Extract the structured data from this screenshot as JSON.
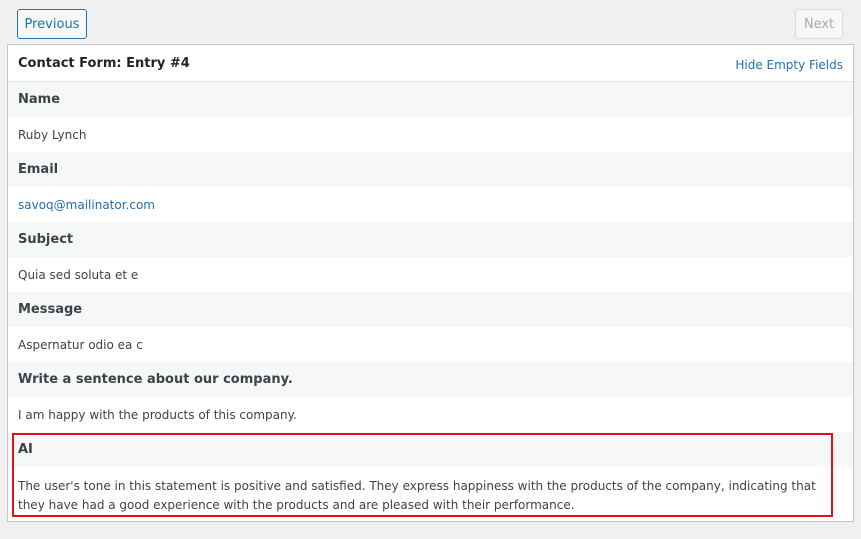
{
  "nav": {
    "previous_label": "Previous",
    "next_label": "Next"
  },
  "entry": {
    "title": "Contact Form: Entry #4",
    "hide_empty_label": "Hide Empty Fields",
    "fields": [
      {
        "label": "Name",
        "value": "Ruby Lynch"
      },
      {
        "label": "Email",
        "value": "savoq@mailinator.com"
      },
      {
        "label": "Subject",
        "value": "Quia sed soluta et e"
      },
      {
        "label": "Message",
        "value": "Aspernatur odio ea c"
      },
      {
        "label": "Write a sentence about our company.",
        "value": "I am happy with the products of this company."
      },
      {
        "label": "AI",
        "value": "The user's tone in this statement is positive and satisfied. They express happiness with the products of the company, indicating that they have had a good experience with the products and are pleased with their performance."
      }
    ]
  },
  "colors": {
    "accent": "#2271b1",
    "highlight_border": "#e3101a",
    "label_row_bg": "#f6f7f7"
  }
}
